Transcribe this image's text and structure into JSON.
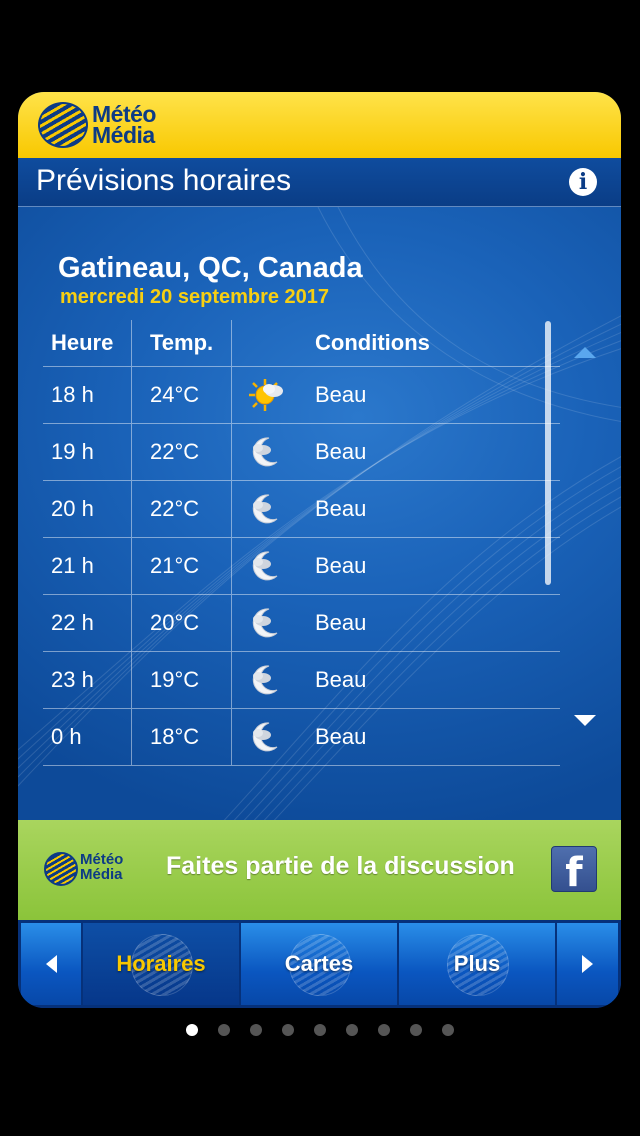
{
  "app": {
    "logo_line1": "Météo",
    "logo_line2": "Média"
  },
  "header": {
    "title": "Prévisions horaires",
    "info_icon": "info-icon"
  },
  "location": {
    "city": "Gatineau, QC, Canada",
    "date": "mercredi 20 septembre 2017"
  },
  "table": {
    "headers": [
      "Heure",
      "Temp.",
      "Conditions"
    ],
    "rows": [
      {
        "hour": "18 h",
        "temp": "24°C",
        "icon": "sun-cloud-icon",
        "condition": "Beau"
      },
      {
        "hour": "19 h",
        "temp": "22°C",
        "icon": "moon-cloud-icon",
        "condition": "Beau"
      },
      {
        "hour": "20 h",
        "temp": "22°C",
        "icon": "moon-cloud-icon",
        "condition": "Beau"
      },
      {
        "hour": "21 h",
        "temp": "21°C",
        "icon": "moon-cloud-icon",
        "condition": "Beau"
      },
      {
        "hour": "22 h",
        "temp": "20°C",
        "icon": "moon-cloud-icon",
        "condition": "Beau"
      },
      {
        "hour": "23 h",
        "temp": "19°C",
        "icon": "moon-cloud-icon",
        "condition": "Beau"
      },
      {
        "hour": "0 h",
        "temp": "18°C",
        "icon": "moon-cloud-icon",
        "condition": "Beau"
      }
    ]
  },
  "banner": {
    "logo_line1": "Météo",
    "logo_line2": "Média",
    "text": "Faites partie de la discussion",
    "facebook_glyph": "f"
  },
  "nav": {
    "items": [
      "Horaires",
      "Cartes",
      "Plus"
    ],
    "active_index": 0
  },
  "pager": {
    "count": 9,
    "active_index": 0
  },
  "colors": {
    "brand_yellow": "#f8c800",
    "brand_blue": "#0b3c86",
    "date_yellow": "#f7cf12",
    "banner_green": "#8bc43a"
  }
}
